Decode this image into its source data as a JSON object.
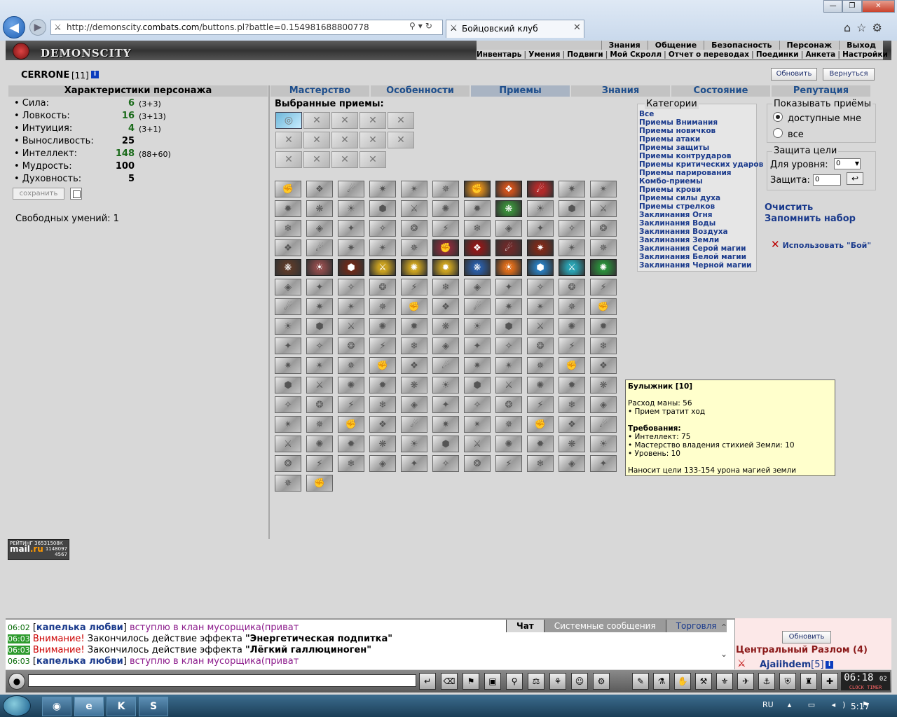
{
  "browser": {
    "url_prefix": "http://demonscity.",
    "url_domain": "combats.com",
    "url_path": "/buttons.pl?battle=0.154981688800778",
    "tab_title": "Бойцовский клуб",
    "window_controls": [
      "—",
      "❐",
      "✕"
    ]
  },
  "game": {
    "logo_text": "DEMONSCITY",
    "top_menu": [
      "Знания",
      "Общение",
      "Безопасность",
      "Персонаж",
      "Выход"
    ],
    "sub_menu": [
      "Инвентарь",
      "Умения",
      "Подвиги",
      "Мой Скролл",
      "Отчет о переводах",
      "Поединки",
      "Анкета",
      "Настройки"
    ],
    "character": {
      "name": "CERRONE",
      "level": "[11]"
    },
    "buttons": {
      "refresh": "Обновить",
      "back": "Вернуться",
      "save": "сохранить"
    },
    "stats_title": "Характеристики персонажа",
    "stats": [
      {
        "name": "• Сила:",
        "value": "6",
        "bonus": "(3+3)",
        "green": true
      },
      {
        "name": "• Ловкость:",
        "value": "16",
        "bonus": "(3+13)",
        "green": true
      },
      {
        "name": "• Интуиция:",
        "value": "4",
        "bonus": "(3+1)",
        "green": true
      },
      {
        "name": "• Выносливость:",
        "value": "25",
        "bonus": "",
        "green": false
      },
      {
        "name": "• Интеллект:",
        "value": "148",
        "bonus": "(88+60)",
        "green": true
      },
      {
        "name": "• Мудрость:",
        "value": "100",
        "bonus": "",
        "green": false
      },
      {
        "name": "• Духовность:",
        "value": "5",
        "bonus": "",
        "green": false
      }
    ],
    "free_skills": "Свободных умений: 1",
    "tabs": [
      "Мастерство",
      "Особенности",
      "Приемы",
      "Знания",
      "Состояние",
      "Репутация"
    ],
    "active_tab": "Приемы",
    "selected_title": "Выбранные приемы:",
    "categories_title": "Категории",
    "categories": [
      "Все",
      "Приемы Внимания",
      "Приемы новичков",
      "Приемы атаки",
      "Приемы защиты",
      "Приемы контрударов",
      "Приемы критических ударов",
      "Приемы парирования",
      "Комбо-приемы",
      "Приемы крови",
      "Приемы силы духа",
      "Приемы стрелков",
      "Заклинания Огня",
      "Заклинания Воды",
      "Заклинания Воздуха",
      "Заклинания Земли",
      "Заклинания Серой магии",
      "Заклинания Белой магии",
      "Заклинания Черной магии"
    ],
    "show": {
      "title": "Показывать приёмы",
      "opt1": "доступные мне",
      "opt2": "все"
    },
    "protect": {
      "title": "Защита цели",
      "level_label": "Для уровня:",
      "level_value": "0",
      "def_label": "Защита:",
      "def_value": "0"
    },
    "actions": {
      "clear": "Очистить",
      "remember": "Запомнить набор",
      "use_battle": "Использовать \"Бой\""
    },
    "tooltip": {
      "title": "Булыжник [10]",
      "mana": "Расход маны: 56",
      "turn": "• Прием тратит ход",
      "req_title": "Требования:",
      "req1": "• Интеллект: 75",
      "req2": "• Мастерство владения стихией Земли: 10",
      "req3": "• Уровень: 10",
      "desc": "Наносит цели 133-154 урона магией земли"
    },
    "rating": {
      "label": "РЕЙТИНГ",
      "num1": "36531508К",
      "mail": "mail",
      "ru": ".ru",
      "num2": "1148097",
      "num3": "4567"
    }
  },
  "chat": {
    "tabs": [
      "Чат",
      "Системные сообщения",
      "Торговля"
    ],
    "lines": [
      {
        "time": "06:02",
        "nick": "капелька любви",
        "text": "вступлю в клан мусорщика(приват"
      },
      {
        "time": "06:03",
        "warn": "Внимание!",
        "text": " Закончилось действие эффекта ",
        "quote": "\"Энергетическая подпитка\""
      },
      {
        "time": "06:03",
        "warn": "Внимание!",
        "text": " Закончилось действие эффекта ",
        "quote": "\"Лёгкий галлюциноген\""
      },
      {
        "time": "06:03",
        "nick": "капелька любви",
        "text": "вступлю в клан мусорщика(приват"
      }
    ],
    "refresh": "Обновить",
    "location": "Центральный Разлом (4)",
    "player": "Ajaiihdem",
    "player_level": "[5]",
    "clock": "06:18",
    "clock_sec": "02",
    "clock_label": "CLOCK TIMER"
  },
  "taskbar": {
    "lang": "RU",
    "time": "5:17"
  }
}
